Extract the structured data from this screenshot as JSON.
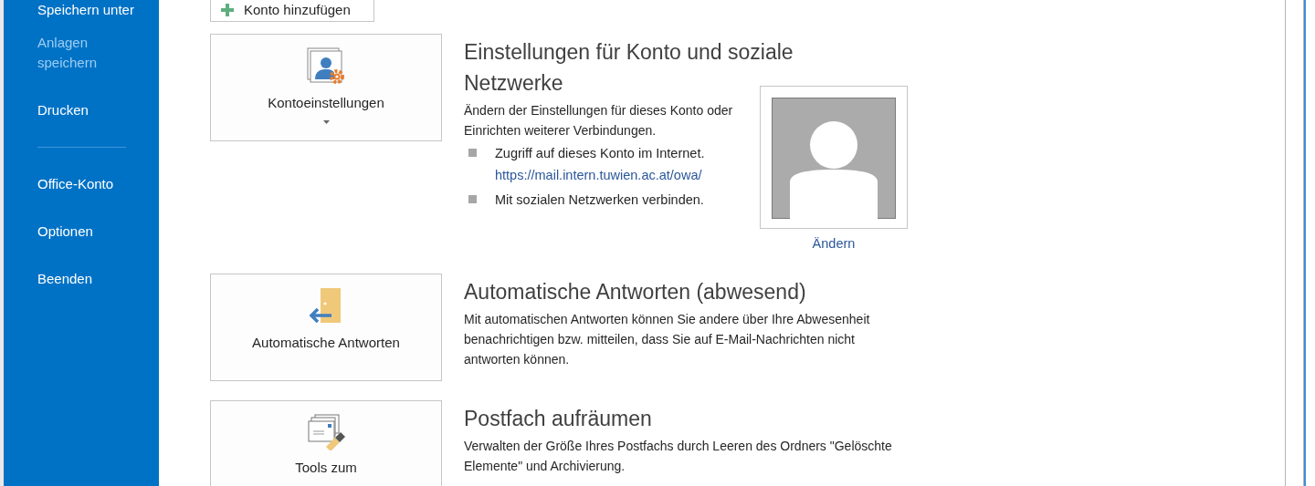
{
  "sidebar": {
    "items": [
      {
        "kind": "item",
        "label": "Speichern unter",
        "disabled": false
      },
      {
        "kind": "item",
        "label": "Anlagen speichern",
        "disabled": true
      },
      {
        "kind": "item",
        "label": "Drucken",
        "disabled": false
      },
      {
        "kind": "divider"
      },
      {
        "kind": "item",
        "label": "Office-Konto",
        "disabled": false
      },
      {
        "kind": "item",
        "label": "Optionen",
        "disabled": false
      },
      {
        "kind": "item",
        "label": "Beenden",
        "disabled": false
      }
    ]
  },
  "add_account_button": {
    "label": "Konto hinzufügen"
  },
  "sections": [
    {
      "kind": "account",
      "tile_label": "Kontoeinstellungen",
      "heading": "Einstellungen für Konto und soziale Netzwerke",
      "description": "Ändern der Einstellungen für dieses Konto oder Einrichten weiterer Verbindungen.",
      "bullets": [
        {
          "text": "Zugriff auf dieses Konto im Internet.",
          "link": "https://mail.intern.tuwien.ac.at/owa/"
        },
        {
          "text": "Mit sozialen Netzwerken verbinden."
        }
      ],
      "photo": {
        "link": "Ändern"
      }
    },
    {
      "kind": "auto_reply",
      "tile_label": "Automatische Antworten",
      "heading": "Automatische Antworten (abwesend)",
      "description": "Mit automatischen Antworten können Sie andere über Ihre Abwesenheit benachrichtigen bzw. mitteilen, dass Sie auf E-Mail-Nachrichten nicht antworten können."
    },
    {
      "kind": "cleanup",
      "tile_label": "Tools zum",
      "heading": "Postfach aufräumen",
      "description": "Verwalten der Größe Ihres Postfachs durch Leeren des Ordners \"Gelöschte Elemente\" und Archivierung."
    }
  ]
}
